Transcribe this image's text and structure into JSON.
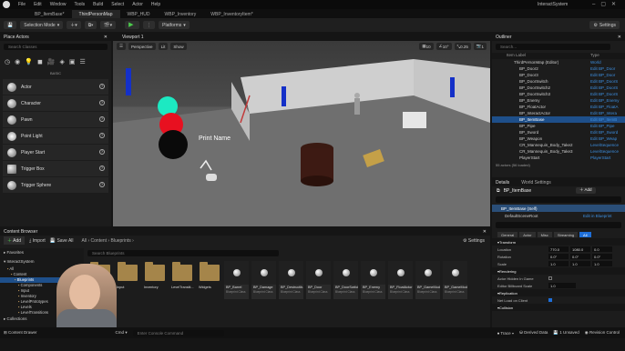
{
  "menu": {
    "items": [
      "File",
      "Edit",
      "Window",
      "Tools",
      "Build",
      "Select",
      "Actor",
      "Help"
    ],
    "title": "InteractSystem"
  },
  "tabs": [
    "BP_ItemBase*",
    "ThirdPersonMap",
    "WBP_HUD",
    "WBP_Inventory",
    "WBP_InventoryItem*"
  ],
  "toolbar": {
    "selection_mode": "Selection Mode",
    "platforms": "Platforms",
    "settings": "Settings"
  },
  "place_actors": {
    "title": "Place Actors",
    "search_placeholder": "Search Classes",
    "section": "BASIC",
    "items": [
      "Actor",
      "Character",
      "Pawn",
      "Point Light",
      "Player Start",
      "Trigger Box",
      "Trigger Sphere"
    ]
  },
  "viewport": {
    "title": "Viewport 1",
    "perspective": "Perspective",
    "lit": "Lit",
    "show": "Show",
    "grid": "10",
    "angle": "10°",
    "scale": "0.25",
    "cam": "1",
    "print_label": "Print Name"
  },
  "outliner": {
    "title": "Outliner",
    "search_placeholder": "Search...",
    "col_label": "Item Label",
    "col_type": "Type",
    "rows": [
      {
        "label": "ThirdPersonMap (Editor)",
        "type": "World"
      },
      {
        "label": "BP_Door2",
        "type": "Edit BP_Door"
      },
      {
        "label": "BP_Door3",
        "type": "Edit BP_Door"
      },
      {
        "label": "BP_DoorSwitch",
        "type": "Edit BP_DoorS"
      },
      {
        "label": "BP_DoorSwitch2",
        "type": "Edit BP_DoorS"
      },
      {
        "label": "BP_DoorSwitch3",
        "type": "Edit BP_DoorS"
      },
      {
        "label": "BP_Enemy",
        "type": "Edit BP_Enemy"
      },
      {
        "label": "BP_FloatActor",
        "type": "Edit BP_FloatA"
      },
      {
        "label": "BP_InteractActor",
        "type": "Edit BP_Intera"
      },
      {
        "label": "BP_ItemBase",
        "type": "Edit BP_ItemB"
      },
      {
        "label": "BP_Pipe",
        "type": "Edit BP_Pipe"
      },
      {
        "label": "BP_Sword",
        "type": "Edit BP_Sword"
      },
      {
        "label": "BP_Weapon",
        "type": "Edit BP_Weap"
      },
      {
        "label": "CR_Mannequin_Body_Take2",
        "type": "LevelSequence"
      },
      {
        "label": "CR_Mannequin_Body_Take3",
        "type": "LevelSequence"
      },
      {
        "label": "PlayerStart",
        "type": "PlayerStart"
      }
    ],
    "count": "55 actors (56 loaded)"
  },
  "details": {
    "title": "Details",
    "world_settings": "World Settings",
    "object": "BP_ItemBase",
    "self": "BP_ItemBase (Self)",
    "root": "DefaultSceneRoot",
    "edit_bp": "Edit in Blueprint",
    "filters": [
      "General",
      "Actor",
      "Misc",
      "Streaming",
      "All"
    ],
    "transform": "Transform",
    "location": [
      "770.0",
      "1080.0",
      "0.0"
    ],
    "rotation": [
      "0.0°",
      "0.0°",
      "0.0°"
    ],
    "scale": [
      "1.0",
      "1.0",
      "1.0"
    ],
    "rendering": "Rendering",
    "hidden": "Actor Hidden In Game",
    "billboard": "Editor Billboard Scale",
    "billboard_val": "1.0",
    "replication": "Replication",
    "net_load": "Net Load on Client",
    "collision": "Collision",
    "labels": {
      "location": "Location",
      "rotation": "Rotation",
      "scale": "Scale"
    }
  },
  "content_browser": {
    "title": "Content Browser",
    "add": "Add",
    "import": "Import",
    "save_all": "Save All",
    "path": [
      "All",
      "Content",
      "Blueprints"
    ],
    "settings": "Settings",
    "search_placeholder": "Search Blueprints",
    "favorites": "Favorites",
    "project": "InteractSystem",
    "tree": [
      "All",
      "Content",
      "Blueprints",
      "Components",
      "Input",
      "Inventory",
      "LevelPrototypes",
      "Levels",
      "LevelTransitions"
    ],
    "collections": "Collections",
    "folders": [
      "Components",
      "Input",
      "Inventory",
      "LevelTransiti...",
      "Widgets"
    ],
    "assets": [
      {
        "name": "BP_Barrel",
        "sub": "Blueprint Class"
      },
      {
        "name": "BP_Damage",
        "sub": "Blueprint Class"
      },
      {
        "name": "BP_Destructib...",
        "sub": "Blueprint Class"
      },
      {
        "name": "BP_Door",
        "sub": "Blueprint Class"
      },
      {
        "name": "BP_DoorSwitch",
        "sub": "Blueprint Class"
      },
      {
        "name": "BP_Enemy",
        "sub": "Blueprint Class"
      },
      {
        "name": "BP_FloatActor",
        "sub": "Blueprint Class"
      },
      {
        "name": "BP_GameMode",
        "sub": "Blueprint Class"
      },
      {
        "name": "BP_GameModeB...",
        "sub": "Blueprint Class"
      }
    ]
  },
  "status": {
    "content_drawer": "Content Drawer",
    "cmd": "Cmd",
    "console_placeholder": "Enter Console Command",
    "trace": "Trace",
    "derived": "Derived Data",
    "unsaved": "1 Unsaved",
    "revision": "Revision Control"
  }
}
